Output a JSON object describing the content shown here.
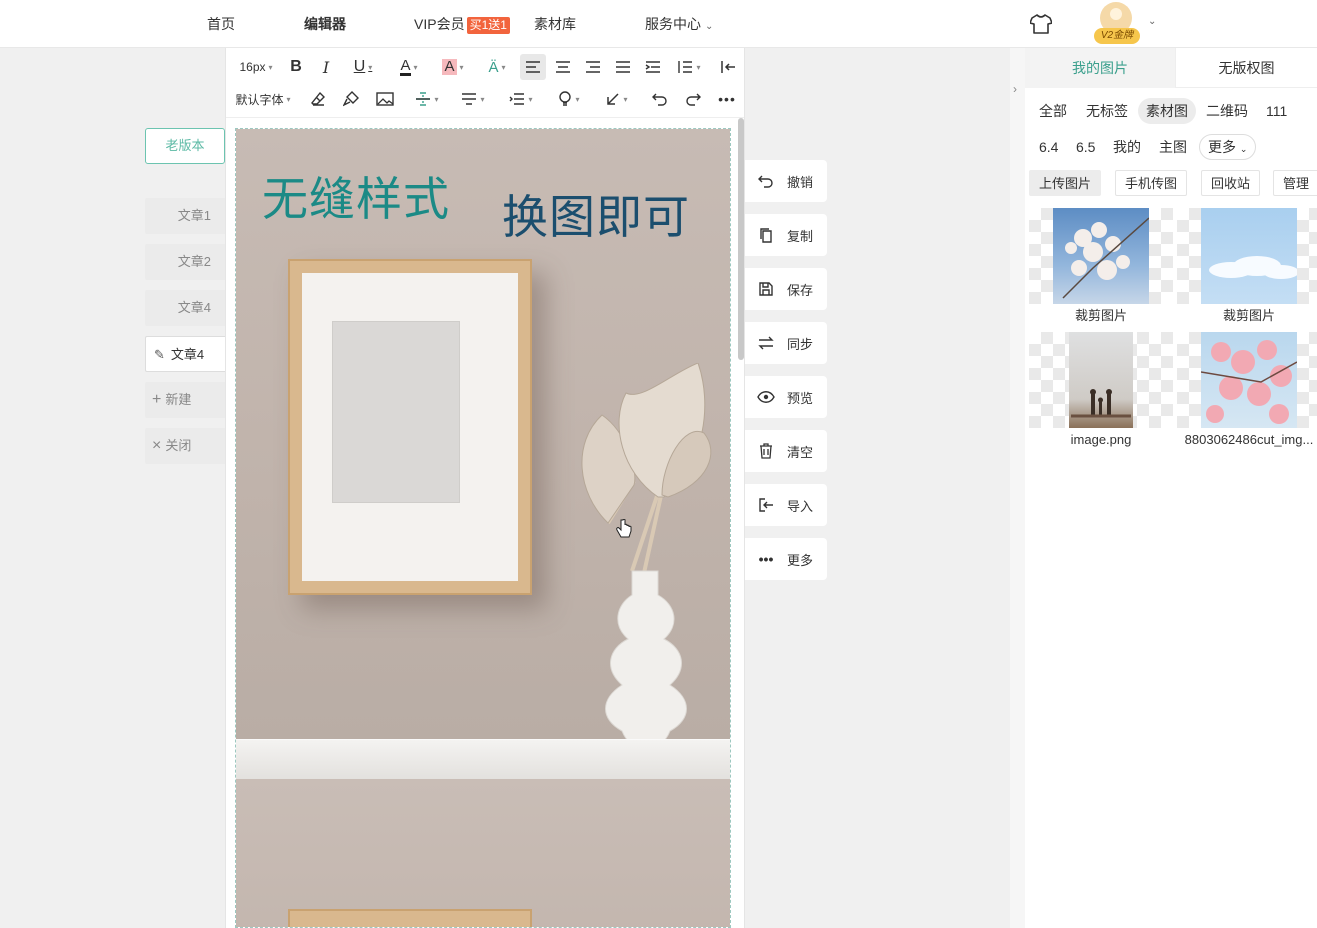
{
  "nav": {
    "home": "首页",
    "editor": "编辑器",
    "vip": "VIP会员",
    "vip_badge": "买1送1",
    "library": "素材库",
    "service": "服务中心",
    "avatar_tag": "V2金牌"
  },
  "left": {
    "old_version": "老版本",
    "docs": [
      "文章1",
      "文章2",
      "文章4",
      "文章4"
    ],
    "new": "新建",
    "close": "关闭"
  },
  "toolbar": {
    "font_size": "16px",
    "font_family": "默认字体"
  },
  "canvas": {
    "title_left": "无缝样式",
    "title_right": "换图即可"
  },
  "actions": [
    "撤销",
    "复制",
    "保存",
    "同步",
    "预览",
    "清空",
    "导入",
    "更多"
  ],
  "right": {
    "tabs": [
      "我的图片",
      "无版权图"
    ],
    "filters_row1": [
      "全部",
      "无标签",
      "素材图",
      "二维码",
      "111"
    ],
    "filters_row2": [
      "6.4",
      "6.5",
      "我的",
      "主图",
      "更多"
    ],
    "buttons": [
      "上传图片",
      "手机传图",
      "回收站",
      "管理"
    ],
    "images": [
      {
        "caption": "裁剪图片"
      },
      {
        "caption": "裁剪图片"
      },
      {
        "caption": "image.png"
      },
      {
        "caption": "8803062486cut_img..."
      }
    ]
  },
  "colors": {
    "accent": "#3a9f8c",
    "badge": "#f2643d",
    "title_left": "#1b8a86",
    "title_right": "#1b4e6e"
  }
}
